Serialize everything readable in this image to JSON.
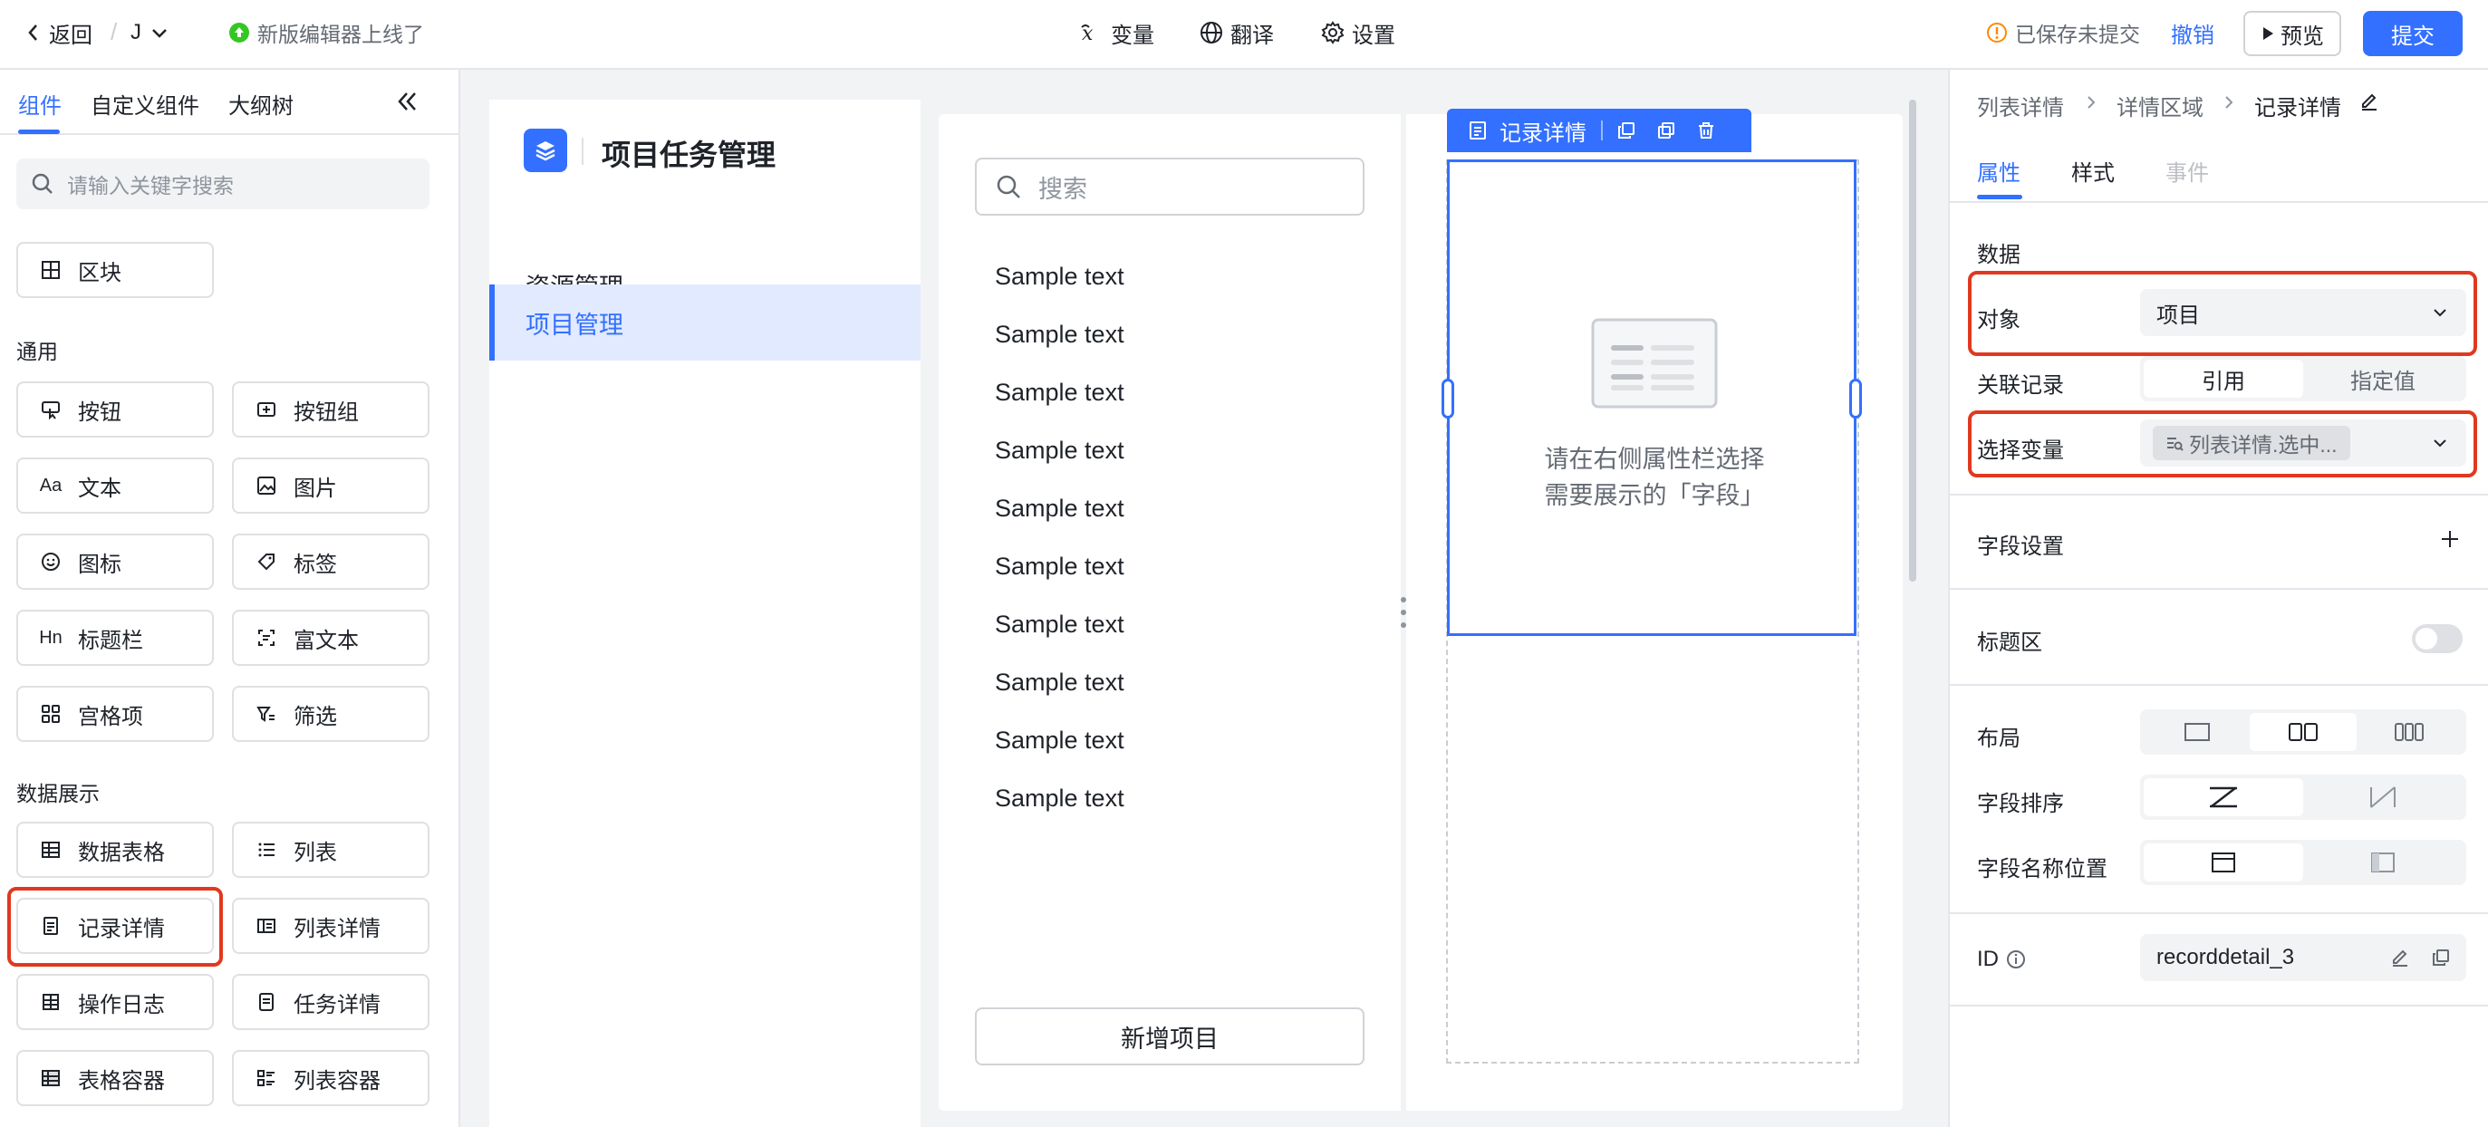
{
  "topbar": {
    "back_label": "返回",
    "app_letter": "J",
    "notice": "新版编辑器上线了",
    "variables_label": "变量",
    "translate_label": "翻译",
    "settings_label": "设置",
    "save_status": "已保存未提交",
    "undo_label": "撤销",
    "preview_label": "预览",
    "submit_label": "提交"
  },
  "left_panel": {
    "tabs": [
      "组件",
      "自定义组件",
      "大纲树"
    ],
    "search_placeholder": "请输入关键字搜索",
    "block_label": "区块",
    "sections": [
      {
        "title": "通用",
        "items": [
          "按钮",
          "按钮组",
          "文本",
          "图片",
          "图标",
          "标签",
          "标题栏",
          "富文本",
          "宫格项",
          "筛选"
        ]
      },
      {
        "title": "数据展示",
        "items": [
          "数据表格",
          "列表",
          "记录详情",
          "列表详情",
          "操作日志",
          "任务详情",
          "表格容器",
          "列表容器"
        ]
      }
    ]
  },
  "app_preview": {
    "title": "项目任务管理",
    "nav": [
      "资源管理",
      "项目管理"
    ],
    "list": {
      "search_placeholder": "搜索",
      "items": [
        "Sample text",
        "Sample text",
        "Sample text",
        "Sample text",
        "Sample text",
        "Sample text",
        "Sample text",
        "Sample text",
        "Sample text",
        "Sample text"
      ],
      "add_button": "新增项目"
    },
    "detail": {
      "toolbar_label": "记录详情",
      "empty_line1": "请在右侧属性栏选择",
      "empty_line2": "需要展示的「字段」"
    }
  },
  "right_panel": {
    "breadcrumb": [
      "列表详情",
      "详情区域",
      "记录详情"
    ],
    "tabs": [
      "属性",
      "样式",
      "事件"
    ],
    "data_section": "数据",
    "object_label": "对象",
    "object_value": "项目",
    "related_label": "关联记录",
    "related_options": [
      "引用",
      "指定值"
    ],
    "variable_label": "选择变量",
    "variable_value": "列表详情.选中...",
    "field_settings": "字段设置",
    "title_area": "标题区",
    "layout_label": "布局",
    "field_order_label": "字段排序",
    "field_name_pos_label": "字段名称位置",
    "id_label": "ID",
    "id_value": "recorddetail_3"
  },
  "colors": {
    "primary": "#3370ff",
    "highlight": "#e0391f",
    "warning": "#ff8800",
    "success": "#34c724"
  }
}
